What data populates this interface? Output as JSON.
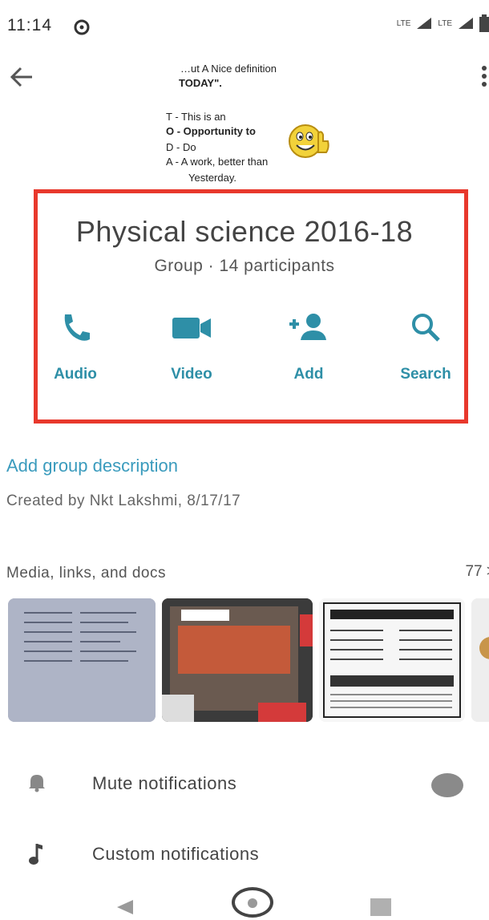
{
  "status_bar": {
    "time": "11:14",
    "network_1": "LTE",
    "network_2": "LTE"
  },
  "header": {
    "back_icon": "arrow-left-icon",
    "more_icon": "more-vertical-icon"
  },
  "group_photo": {
    "lines": [
      "…ut A Nice definition",
      "TODAY\".",
      "T - This is an",
      "O - Opportunity to",
      "D - Do",
      "A - A work, better than",
      "Yesterday."
    ]
  },
  "group": {
    "name": "Physical science 2016-18",
    "meta": "Group · 14 participants"
  },
  "actions": [
    {
      "label": "Audio",
      "icon": "phone-icon"
    },
    {
      "label": "Video",
      "icon": "video-camera-icon"
    },
    {
      "label": "Add",
      "icon": "add-person-icon"
    },
    {
      "label": "Search",
      "icon": "search-icon"
    }
  ],
  "description": {
    "add_label": "Add group description",
    "created_by": "Created by Nkt Lakshmi, 8/17/17"
  },
  "media": {
    "label": "Media, links, and docs",
    "count": "77 >"
  },
  "settings": [
    {
      "label": "Mute notifications",
      "icon": "bell-icon"
    },
    {
      "label": "Custom notifications",
      "icon": "music-note-icon"
    }
  ],
  "colors": {
    "accent": "#2e8fa7",
    "highlight": "#e8382c",
    "link": "#3a9bbd"
  }
}
